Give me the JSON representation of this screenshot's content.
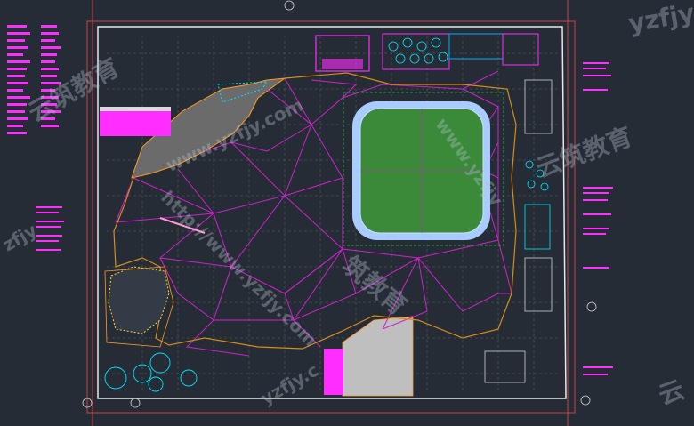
{
  "title": "",
  "watermarks": {
    "w1": "yzfjy",
    "w2": "www.yzfjy.com",
    "w3": "云筑教育",
    "w4": "http://www.yzfjy.com",
    "w5": "云筑教育",
    "w6": "www.yzfjy",
    "w7": "云",
    "w8": "zfjy",
    "w9": "筑教育",
    "w10": "yzfjy.c"
  },
  "colors": {
    "background": "#262c36",
    "mesh": "#cc22cc",
    "pool_water": "#3a8a3a",
    "pool_edge": "#a8ccff",
    "annotation": "#ff2dff",
    "building": "#6b6b6b",
    "plaza": "#bfbfbf",
    "trees": "#00e5ff",
    "grid": "#7a8a7a"
  }
}
